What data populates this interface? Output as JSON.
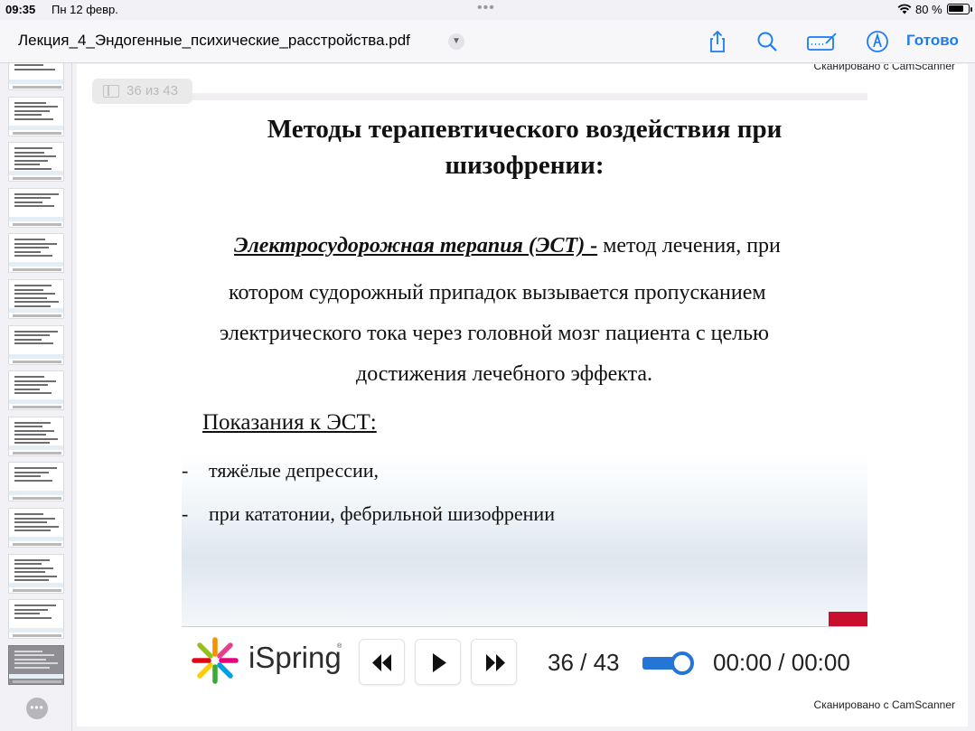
{
  "status_bar": {
    "time": "09:35",
    "date": "Пн 12 февр.",
    "battery_percent": "80 %",
    "battery_level": 0.8
  },
  "toolbar": {
    "title": "Лекция_4_Эндогенные_психические_расстройства.pdf",
    "done_label": "Готово",
    "icons": [
      "share-icon",
      "search-icon",
      "markup-icon",
      "pencil-tip-icon"
    ],
    "accent_color": "#1a7cf5"
  },
  "page_indicator": "36 из 43",
  "watermark": "Сканировано с CamScanner",
  "slide": {
    "title_line1": "Методы терапевтического воздействия при",
    "title_line2": "шизофрении:",
    "definition_term": "Электросудорожная терапия (ЭСТ) -",
    "definition_rest": " метод лечения, при",
    "line2": "котором судорожный припадок вызывается пропусканием",
    "line3": "электрического тока через головной мозг пациента с целью",
    "line4": "достижения лечебного эффекта.",
    "indications_heading": "Показания к ЭСТ:",
    "bullets": [
      {
        "dash": "-",
        "text": "тяжёлые депрессии,"
      },
      {
        "dash": "-",
        "text": "при кататонии, фебрильной шизофрении"
      }
    ]
  },
  "player": {
    "logo_text": "iSpring",
    "logo_reg": "®",
    "counter": "36 / 43",
    "time": "00:00 / 00:00",
    "accent_color": "#2575d6"
  },
  "sidebar": {
    "thumbnail_count": 14,
    "current_index": 13,
    "more_label": "•••"
  }
}
